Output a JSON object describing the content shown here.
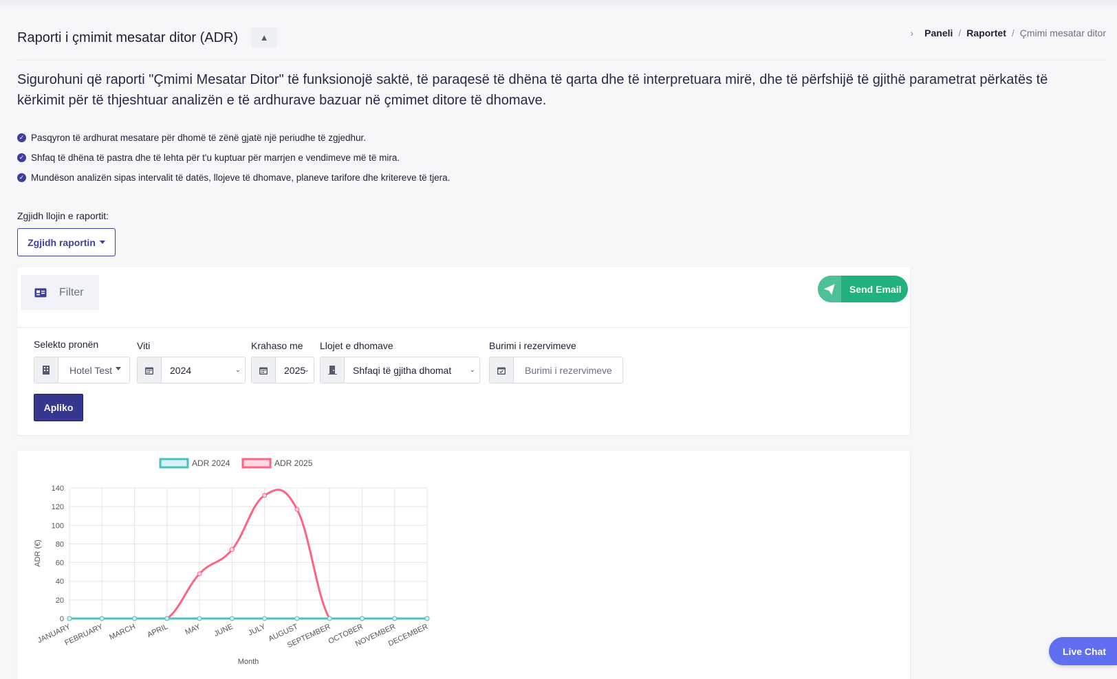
{
  "header": {
    "title": "Raporti i çmimit mesatar ditor (ADR)",
    "collapse_icon": "▲",
    "breadcrumb": [
      "Paneli",
      "Raportet",
      "Çmimi mesatar ditor"
    ]
  },
  "intro": {
    "description": "Sigurohuni që raporti \"Çmimi Mesatar Ditor\" të funksionojë saktë, të paraqesë të dhëna të qarta dhe të interpretuara mirë, dhe të përfshijë të gjithë parametrat përkatës të kërkimit për të thjeshtuar analizën e të ardhurave bazuar në çmimet ditore të dhomave.",
    "features": [
      "Pasqyron të ardhurat mesatare për dhomë të zënë gjatë një periudhe të zgjedhur.",
      "Shfaq të dhëna të pastra dhe të lehta për t'u kuptuar për marrjen e vendimeve më të mira.",
      "Mundëson analizën sipas intervalit të datës, llojeve të dhomave, planeve tarifore dhe kritereve të tjera."
    ]
  },
  "report_select": {
    "label": "Zgjidh llojin e raportit:",
    "button": "Zgjidh raportin"
  },
  "filter": {
    "tab_label": "Filter",
    "send_email": "Send Email",
    "property": {
      "label": "Selekto pronën",
      "value": "Hotel Test"
    },
    "year": {
      "label": "Viti",
      "value": "2024"
    },
    "compare": {
      "label": "Krahaso me",
      "value": "2025"
    },
    "room_types": {
      "label": "Llojet e dhomave",
      "value": "Shfaqi të gjitha dhomat"
    },
    "booking_source": {
      "label": "Burimi i rezervimeve",
      "placeholder": "Burimi i rezervimeve"
    },
    "apply": "Apliko"
  },
  "chart_data": {
    "type": "line",
    "categories": [
      "JANUARY",
      "FEBRUARY",
      "MARCH",
      "APRIL",
      "MAY",
      "JUNE",
      "JULY",
      "AUGUST",
      "SEPTEMBER",
      "OCTOBER",
      "NOVEMBER",
      "DECEMBER"
    ],
    "series": [
      {
        "name": "ADR 2024",
        "color": "#4bc0c0",
        "fill": "#d6f2f2",
        "values": [
          0,
          0,
          0,
          0,
          0,
          0,
          0,
          0,
          0,
          0,
          0,
          0
        ]
      },
      {
        "name": "ADR 2025",
        "color": "#ff6384",
        "fill": "#ffd9e1",
        "values": [
          0,
          0,
          0,
          0,
          48,
          74,
          132,
          117,
          0,
          0,
          0,
          0
        ]
      }
    ],
    "xlabel": "Month",
    "ylabel": "ADR (€)",
    "ylim": [
      0,
      140
    ],
    "yticks": [
      0,
      20,
      40,
      60,
      80,
      100,
      120,
      140
    ],
    "legend": "top"
  },
  "live_chat": "Live Chat"
}
